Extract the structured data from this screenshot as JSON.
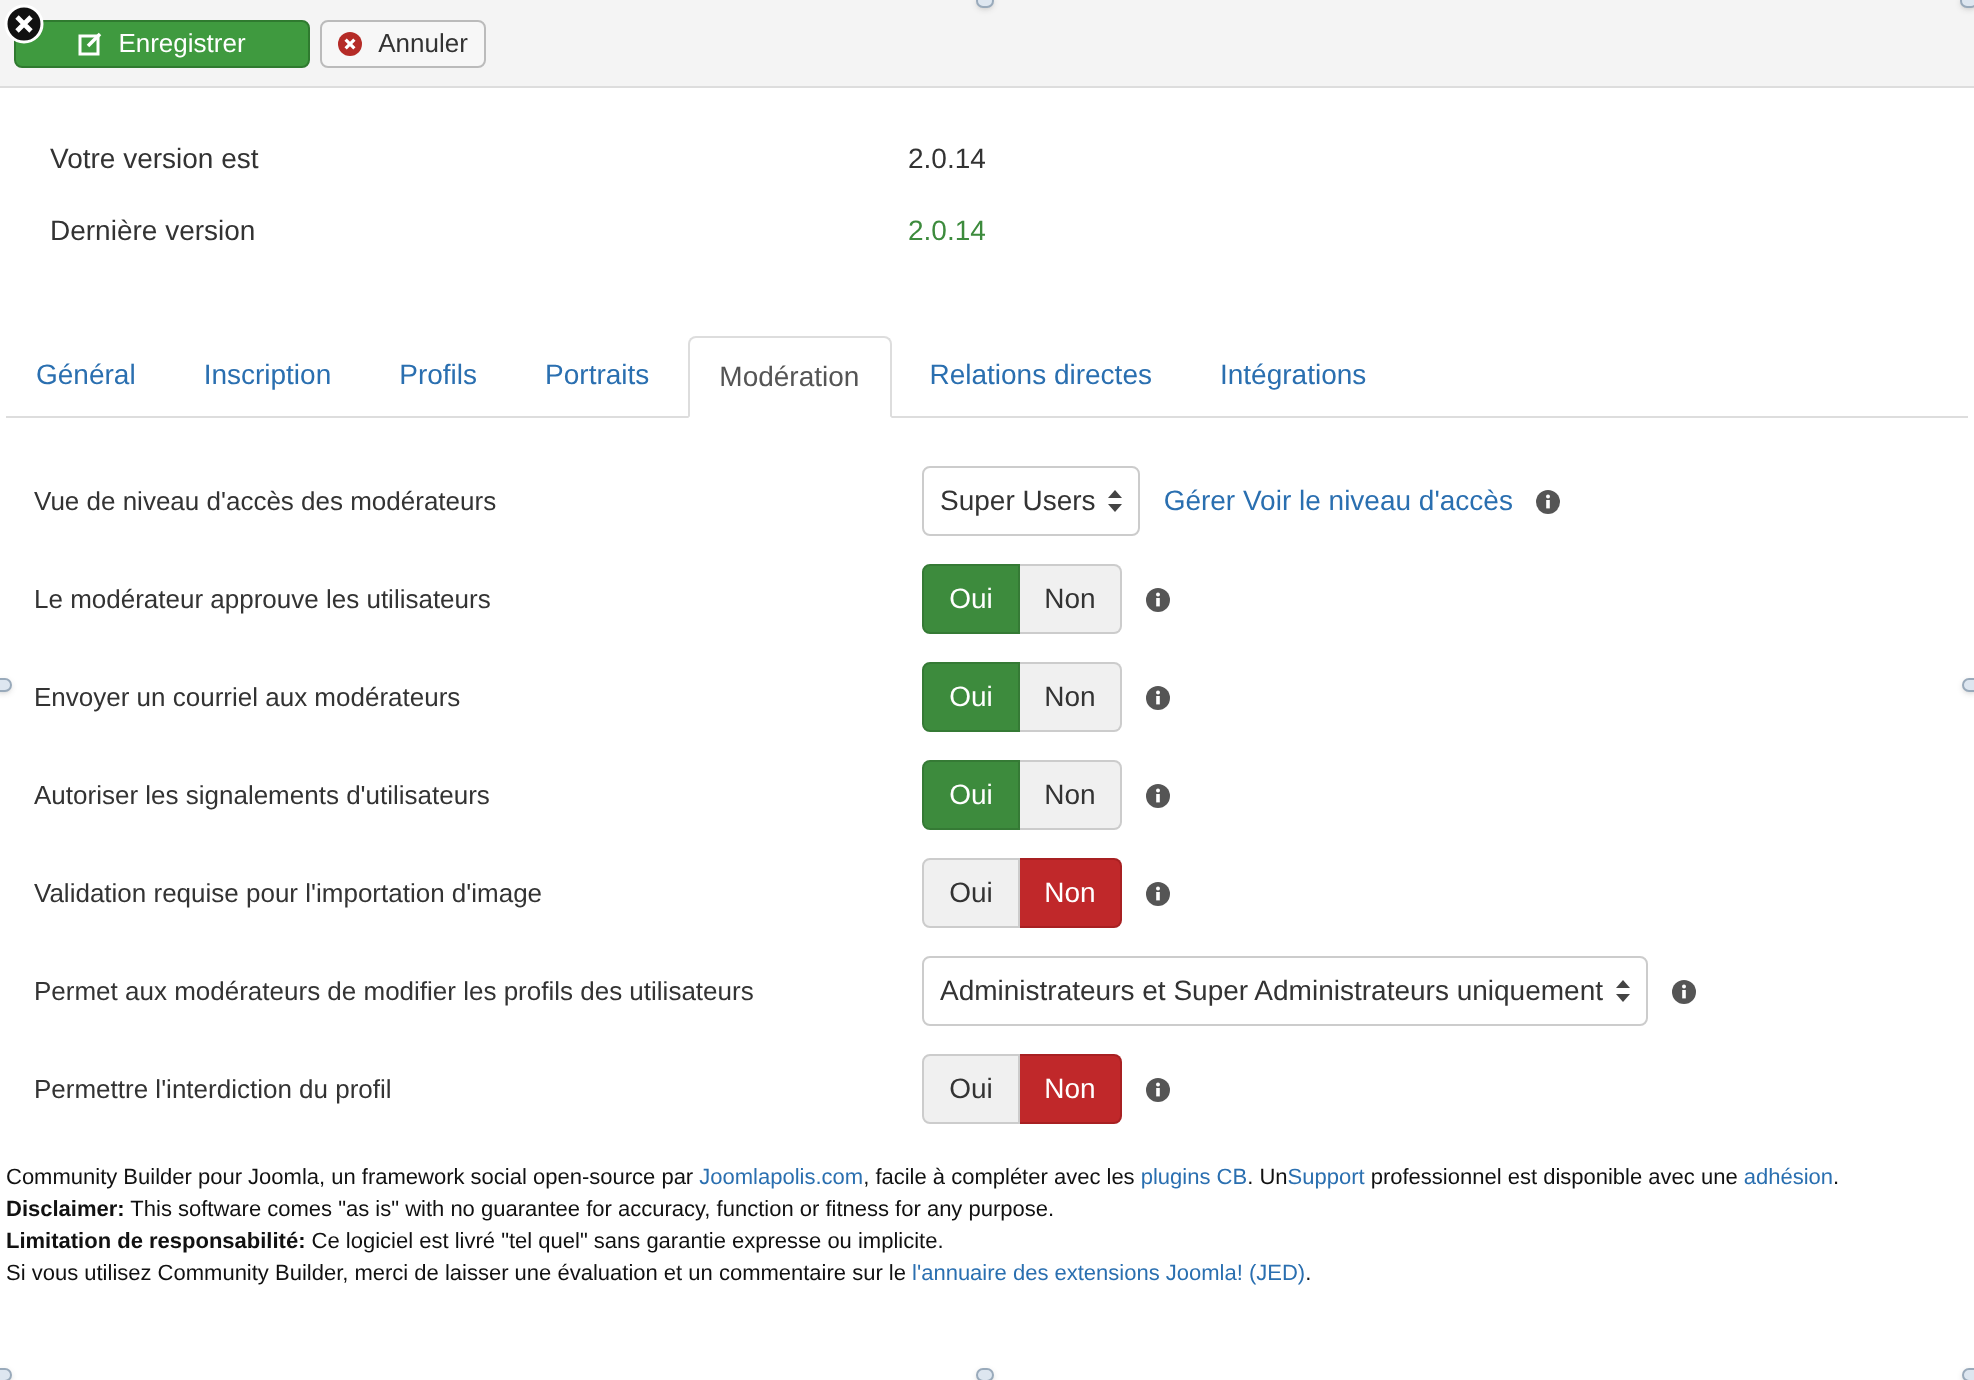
{
  "toolbar": {
    "save_button": "Enregistrer",
    "cancel_button": "Annuler"
  },
  "version": [
    {
      "label": "Votre version est",
      "value": "2.0.14",
      "latest": false
    },
    {
      "label": "Dernière version",
      "value": "2.0.14",
      "latest": true
    }
  ],
  "tabs": [
    {
      "label": "Général",
      "selected": false
    },
    {
      "label": "Inscription",
      "selected": false
    },
    {
      "label": "Profils",
      "selected": false
    },
    {
      "label": "Portraits",
      "selected": false
    },
    {
      "label": "Modération",
      "selected": true
    },
    {
      "label": "Relations directes",
      "selected": false
    },
    {
      "label": "Intégrations",
      "selected": false
    }
  ],
  "settings": [
    {
      "kind": "select",
      "label": "Vue de niveau d'accès des modérateurs",
      "value": "Super Users",
      "link": "Gérer Voir le niveau d'accès"
    },
    {
      "kind": "toggle",
      "label": "Le modérateur approuve les utilisateurs",
      "yes": "Oui",
      "no": "Non",
      "on": true
    },
    {
      "kind": "toggle",
      "label": "Envoyer un courriel aux modérateurs",
      "yes": "Oui",
      "no": "Non",
      "on": true
    },
    {
      "kind": "toggle",
      "label": "Autoriser les signalements d'utilisateurs",
      "yes": "Oui",
      "no": "Non",
      "on": true
    },
    {
      "kind": "toggle",
      "label": "Validation requise pour l'importation d'image",
      "yes": "Oui",
      "no": "Non",
      "on": false
    },
    {
      "kind": "select",
      "label": "Permet aux modérateurs de modifier les profils des utilisateurs",
      "value": "Administrateurs et Super Administrateurs uniquement"
    },
    {
      "kind": "toggle",
      "label": "Permettre l'interdiction du profil",
      "yes": "Oui",
      "no": "Non",
      "on": false
    }
  ],
  "footer": [
    [
      {
        "kind": "text",
        "text": "Community Builder pour Joomla, un framework social open-source par "
      },
      {
        "kind": "link",
        "text": "Joomlapolis.com"
      },
      {
        "kind": "text",
        "text": ", facile à compléter avec les "
      },
      {
        "kind": "link",
        "text": "plugins CB"
      },
      {
        "kind": "text",
        "text": ". Un"
      },
      {
        "kind": "link",
        "text": "Support"
      },
      {
        "kind": "text",
        "text": " professionnel est disponible avec une "
      },
      {
        "kind": "link",
        "text": "adhésion"
      },
      {
        "kind": "text",
        "text": "."
      }
    ],
    [
      {
        "kind": "text",
        "text": "**Disclaimer:** This software comes \"as is\" with no guarantee for accuracy, function or fitness for any purpose."
      }
    ],
    [
      {
        "kind": "text",
        "text": "**Limitation de responsabilité:** Ce logiciel est livré \"tel quel\" sans garantie expresse ou implicite."
      }
    ],
    [
      {
        "kind": "text",
        "text": "Si vous utilisez Community Builder, merci de laisser une évaluation et un commentaire sur le "
      },
      {
        "kind": "link",
        "text": "l'annuaire des extensions Joomla! (JED)"
      },
      {
        "kind": "text",
        "text": "."
      }
    ]
  ]
}
